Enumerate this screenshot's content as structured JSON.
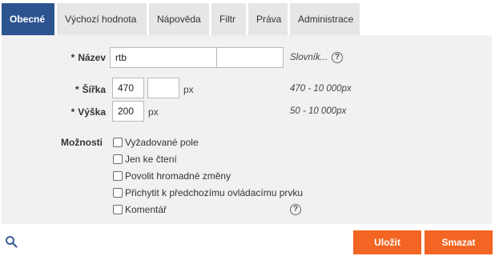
{
  "tabs": [
    {
      "label": "Obecné",
      "active": true
    },
    {
      "label": "Výchozí hodnota",
      "active": false
    },
    {
      "label": "Nápověda",
      "active": false
    },
    {
      "label": "Filtr",
      "active": false
    },
    {
      "label": "Práva",
      "active": false
    },
    {
      "label": "Administrace",
      "active": false
    }
  ],
  "form": {
    "name": {
      "required_mark": "*",
      "label": "Název",
      "value": "rtb",
      "second_value": "",
      "dictionary_link": "Slovník..."
    },
    "width": {
      "required_mark": "*",
      "label": "Šířka",
      "value": "470",
      "second_value": "",
      "unit": "px",
      "hint": "470 - 10 000px"
    },
    "height": {
      "required_mark": "*",
      "label": "Výška",
      "value": "200",
      "unit": "px",
      "hint": "50 - 10 000px"
    },
    "options": {
      "label": "Možnosti",
      "items": [
        {
          "label": "Vyžadované pole",
          "checked": false
        },
        {
          "label": "Jen ke čtení",
          "checked": false
        },
        {
          "label": "Povolit hromadné změny",
          "checked": false
        },
        {
          "label": "Přichytit k předchozímu ovládacímu prvku",
          "checked": false
        },
        {
          "label": "Komentář",
          "checked": false
        }
      ]
    },
    "help_glyph": "?"
  },
  "footer": {
    "save_label": "Uložit",
    "delete_label": "Smazat",
    "accent_color": "#f26522"
  },
  "colors": {
    "active_tab": "#2d5490",
    "inactive_tab": "#e6e6e6",
    "panel": "#f1f1f1"
  },
  "icons": {
    "search": "search-icon",
    "help": "help-circle-icon"
  }
}
